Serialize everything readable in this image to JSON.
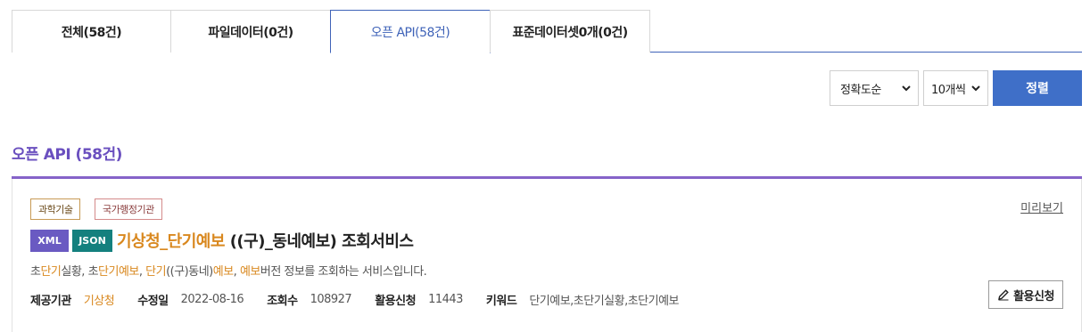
{
  "tabs": [
    {
      "label": "전체(58건)",
      "active": false
    },
    {
      "label": "파일데이터(0건)",
      "active": false
    },
    {
      "label": "오픈 API(58건)",
      "active": true
    },
    {
      "label": "표준데이터셋0개(0건)",
      "active": false
    }
  ],
  "sort": {
    "order_value": "정확도순",
    "per_page_value": "10개씩",
    "button_label": "정렬"
  },
  "section": {
    "title": "오픈 API (58건)"
  },
  "result": {
    "tags": [
      "과학기술",
      "국가행정기관"
    ],
    "preview_label": "미리보기",
    "formats": [
      "XML",
      "JSON"
    ],
    "title_highlight": "기상청_단기예보",
    "title_rest": " ((구)_동네예보) 조회서비스",
    "description": {
      "p1": "초",
      "h1": "단기",
      "p2": "실황, 초",
      "h2": "단기예보",
      "p3": ", ",
      "h3": "단기",
      "p4": "((구)동네)",
      "h4": "예보",
      "p5": ", ",
      "h5": "예보",
      "p6": "버전 정보를 조회하는 서비스입니다."
    },
    "meta": {
      "provider_label": "제공기관",
      "provider_value": "기상청",
      "modified_label": "수정일",
      "modified_value": "2022-08-16",
      "views_label": "조회수",
      "views_value": "108927",
      "usage_label": "활용신청",
      "usage_value": "11443",
      "keyword_label": "키워드",
      "keyword_value": "단기예보,초단기실황,초단기예보"
    },
    "apply_label": "활용신청"
  },
  "colors": {
    "accent_blue": "#3f6fc8",
    "section_purple": "#6a4fbf",
    "highlight_orange": "#d9881f",
    "xml_badge": "#6a5ac2",
    "json_badge": "#14807e"
  }
}
